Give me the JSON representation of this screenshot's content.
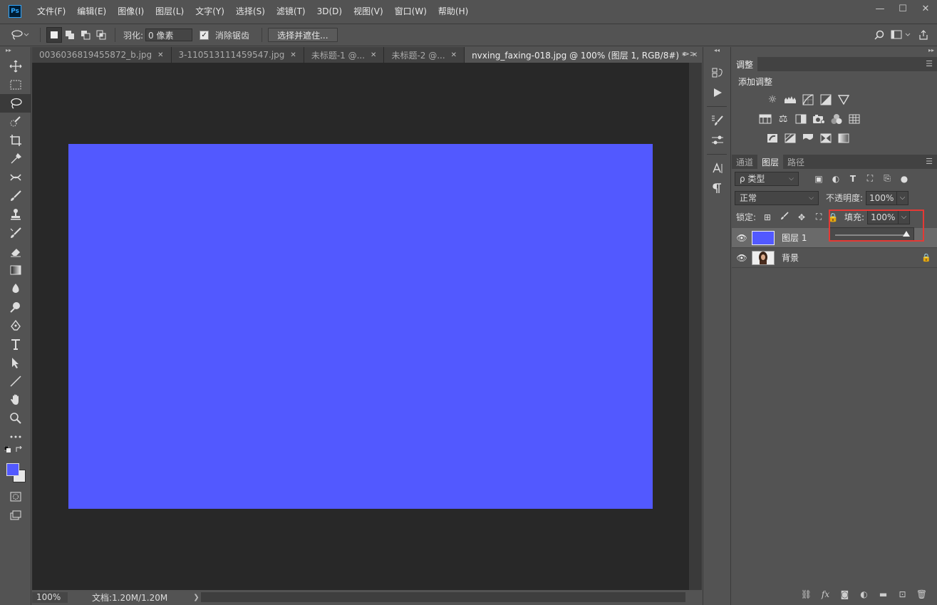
{
  "app": {
    "logo": "Ps",
    "menu": [
      "文件(F)",
      "编辑(E)",
      "图像(I)",
      "图层(L)",
      "文字(Y)",
      "选择(S)",
      "滤镜(T)",
      "3D(D)",
      "视图(V)",
      "窗口(W)",
      "帮助(H)"
    ],
    "window_controls": {
      "minimize": "—",
      "maximize": "☐",
      "close": "✕"
    }
  },
  "options": {
    "feather_label": "羽化:",
    "feather_value": "0 像素",
    "antialias_label": "消除锯齿",
    "antialias_checked": "✓",
    "select_mask_button": "选择并遮住..."
  },
  "doc_tabs": [
    {
      "label": "0036036819455872_b.jpg",
      "close": "✕"
    },
    {
      "label": "3-110513111459547.jpg",
      "close": "✕"
    },
    {
      "label": "未标题-1 @...",
      "close": "✕"
    },
    {
      "label": "未标题-2 @...",
      "close": "✕"
    },
    {
      "label": "nvxing_faxing-018.jpg @ 100% (图层 1, RGB/8#) *",
      "close": "✕"
    }
  ],
  "status": {
    "zoom": "100%",
    "doc_size": "文档:1.20M/1.20M"
  },
  "colors": {
    "canvas_fill": "#5259ff",
    "foreground": "#5259ff",
    "background": "#e8e8e8",
    "highlight": "#e53935"
  },
  "adjustments": {
    "tab": "调整",
    "title": "添加调整"
  },
  "layers_panel": {
    "tabs": [
      "通道",
      "图层",
      "路径"
    ],
    "filter_kind": "ρ 类型",
    "blend_mode": "正常",
    "opacity_label": "不透明度:",
    "opacity_value": "100%",
    "lock_label": "锁定:",
    "fill_label": "填充:",
    "fill_value": "100%",
    "fill_slider_percent": 100,
    "layers": [
      {
        "name": "图层 1",
        "selected": true,
        "locked": false
      },
      {
        "name": "背景",
        "selected": false,
        "locked": true
      }
    ]
  }
}
